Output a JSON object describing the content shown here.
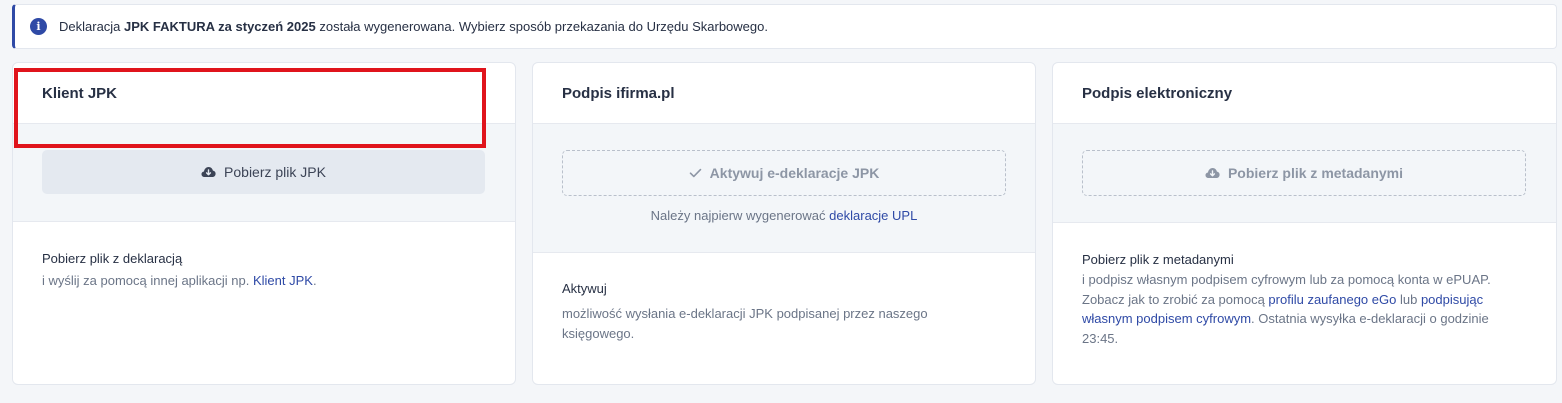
{
  "alert": {
    "prefix": "Deklaracja ",
    "bold": "JPK FAKTURA za styczeń 2025",
    "suffix": " została wygenerowana. Wybierz sposób przekazania do Urzędu Skarbowego."
  },
  "cards": [
    {
      "title": "Klient JPK",
      "button_label": "Pobierz plik JPK",
      "button_icon": "cloud-download-icon",
      "body_title": "Pobierz plik z deklaracją",
      "body_text_before": "i wyślij za pomocą innej aplikacji np. ",
      "body_link": "Klient JPK",
      "body_text_after": "."
    },
    {
      "title": "Podpis ifirma.pl",
      "button_label": "Aktywuj e-deklaracje JPK",
      "button_icon": "check-icon",
      "note_before": "Należy najpierw wygenerować ",
      "note_link": "deklaracje UPL",
      "body_title": "Aktywuj",
      "body_text": "możliwość wysłania e-deklaracji JPK podpisanej przez naszego księgowego."
    },
    {
      "title": "Podpis elektroniczny",
      "button_label": "Pobierz plik z metadanymi",
      "button_icon": "cloud-download-icon",
      "body_title": "Pobierz plik z metadanymi",
      "body_text_1": "i podpisz własnym podpisem cyfrowym lub za pomocą konta w ePUAP. Zobacz jak to zrobić za pomocą ",
      "body_link_1": "profilu zaufanego eGo",
      "body_text_2": " lub ",
      "body_link_2": "podpisując własnym podpisem cyfrowym",
      "body_text_3": ". Ostatnia wysyłka e-deklaracji o godzinie 23:45."
    }
  ],
  "colors": {
    "accent": "#2f4aa6",
    "highlight": "#e0141c",
    "background": "#f4f6f9"
  }
}
